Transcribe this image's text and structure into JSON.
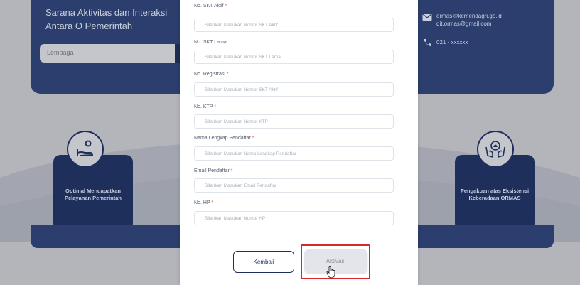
{
  "background": {
    "hero_title": "Sarana Aktivitas dan Interaksi Antara O Pemerintah",
    "search_placeholder": "Lembaga",
    "contact_email_1": "ormas@kemendagri.go.id",
    "contact_email_2": "dit.ormas@gmail.com",
    "contact_phone": "021 - xxxxxx",
    "card_left": "Optimal Mendapatkan Pelayanan Pemerintah",
    "card_right": "Pengakuan atas Eksistensi Keberadaan ORMAS"
  },
  "form": {
    "fields": [
      {
        "label": "No. SKT Aktif",
        "required": true,
        "placeholder": "Silahkan Masukan Nomor SKT Aktif"
      },
      {
        "label": "No. SKT Lama",
        "required": false,
        "placeholder": "Silahkan Masukan Nomor SKT Lama"
      },
      {
        "label": "No. Registrasi",
        "required": true,
        "placeholder": "Silahkan Masukan Nomor SKT Aktif"
      },
      {
        "label": "No. KTP",
        "required": true,
        "placeholder": "Silahkan Masukan Nomor KTP"
      },
      {
        "label": "Nama Lengkap Pendaftar",
        "required": true,
        "placeholder": "Silahkan Masukan Nama Lengkap Pendaftar"
      },
      {
        "label": "Email Pendaftar",
        "required": true,
        "placeholder": "Silahkan Masukan Email Pendaftar"
      },
      {
        "label": "No. HP",
        "required": true,
        "placeholder": "Silahkan Masukan Nomor HP"
      }
    ],
    "required_mark": "*",
    "back_label": "Kembali",
    "activate_label": "Aktivasi"
  },
  "colors": {
    "navy": "#1e2f5c",
    "highlight": "#d8282c"
  }
}
